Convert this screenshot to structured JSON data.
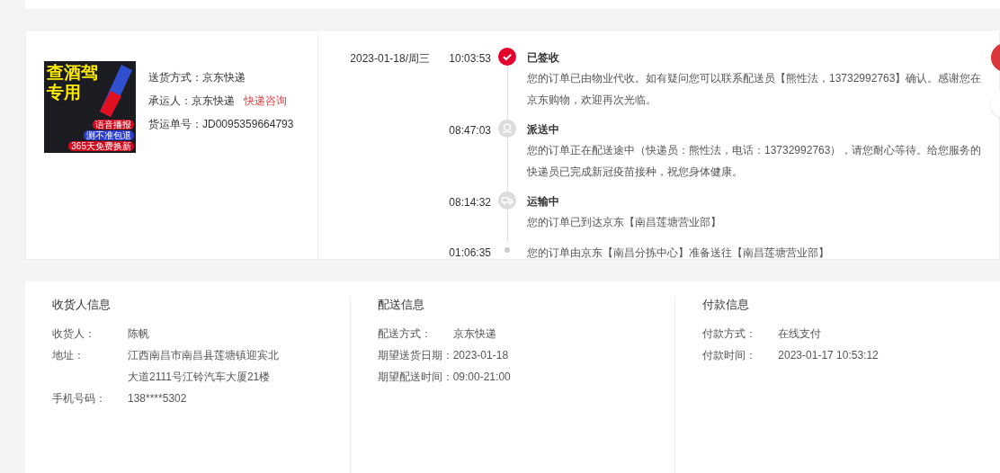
{
  "shipment": {
    "product_image_text": [
      "查酒驾",
      "专用"
    ],
    "product_badges": [
      "语音播报",
      "测不准包退",
      "365天免费换新"
    ],
    "fields": [
      {
        "label": "送货方式：",
        "value": "京东快递"
      },
      {
        "label": "承运人：",
        "value": "京东快递",
        "link": "快递咨询"
      },
      {
        "label": "货运单号：",
        "value": "JD0095359664793"
      }
    ]
  },
  "timeline": [
    {
      "date": "2023-01-18/周三",
      "time": "10:03:53",
      "kind": "signed",
      "title": "已签收",
      "text": "您的订单已由物业代收。如有疑问您可以联系配送员【熊性法，13732992763】确认。感谢您在京东购物，欢迎再次光临。"
    },
    {
      "time": "08:47:03",
      "kind": "delivering",
      "title": "派送中",
      "text": "您的订单正在配送途中（快递员：熊性法，电话：13732992763），请您耐心等待。给您服务的快递员已完成新冠疫苗接种，祝您身体健康。"
    },
    {
      "time": "08:14:32",
      "kind": "transit",
      "title": "运输中",
      "text": "您的订单已到达京东【南昌莲塘营业部】"
    },
    {
      "time": "01:06:35",
      "kind": "step",
      "text": "您的订单由京东【南昌分拣中心】准备送往【南昌莲塘营业部】"
    }
  ],
  "info_sections": [
    {
      "title": "收货人信息",
      "rows": [
        {
          "label": "收货人：",
          "value": [
            "陈帆"
          ]
        },
        {
          "label": "地址：",
          "value": [
            "江西南昌市南昌县莲塘镇迎宾北",
            "大道2111号江铃汽车大厦21楼"
          ]
        },
        {
          "label": "手机号码：",
          "value": [
            "138****5302"
          ]
        }
      ]
    },
    {
      "title": "配送信息",
      "rows": [
        {
          "label": "配送方式：",
          "value": [
            "京东快递"
          ]
        },
        {
          "label": "期望送货日期：",
          "value": [
            "2023-01-18"
          ]
        },
        {
          "label": "期望配送时间：",
          "value": [
            "09:00-21:00"
          ]
        }
      ]
    },
    {
      "title": "付款信息",
      "rows": [
        {
          "label": "付款方式：",
          "value": [
            "在线支付"
          ]
        },
        {
          "label": "付款时间：",
          "value": [
            "2023-01-17 10:53:12"
          ]
        }
      ]
    }
  ]
}
